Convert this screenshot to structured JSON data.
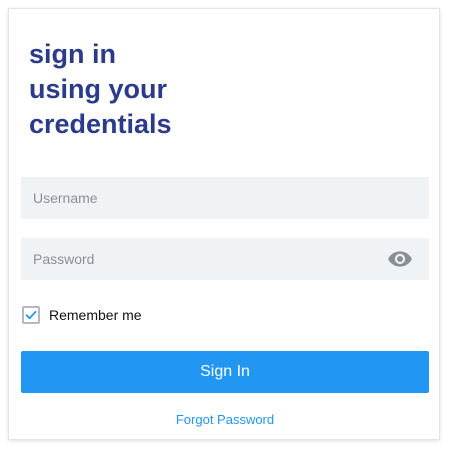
{
  "login": {
    "heading": "sign in\nusing your\ncredentials",
    "username_placeholder": "Username",
    "password_placeholder": "Password",
    "remember_label": "Remember me",
    "remember_checked": true,
    "submit_label": "Sign In",
    "forgot_label": "Forgot Password"
  },
  "icons": {
    "password_toggle": "eye-icon",
    "checkbox_mark": "checkmark-icon"
  },
  "colors": {
    "heading": "#2c3a8c",
    "accent": "#2196f3",
    "field_background": "#f0f3f6"
  }
}
